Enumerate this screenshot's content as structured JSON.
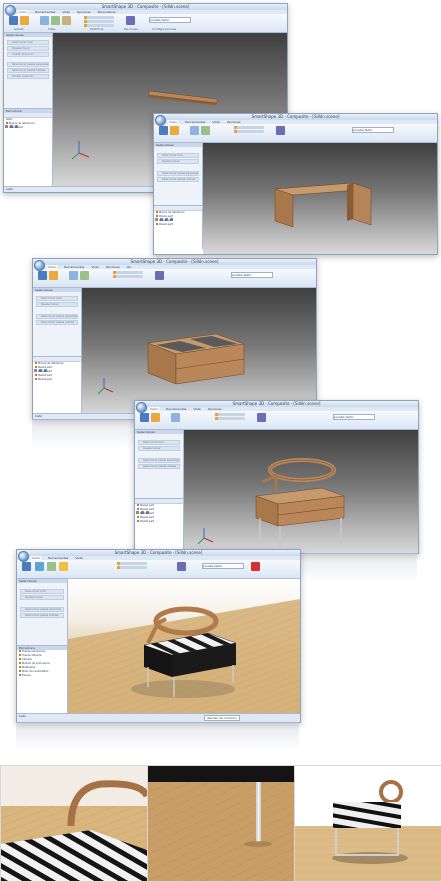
{
  "app": {
    "title": "SmartShape 3D - Composite - [Sillón.scene]",
    "tabs": [
      "Inicio",
      "Herramientas",
      "Vista",
      "Opciones",
      "Personalizar",
      "Ver"
    ],
    "active_tab": "Inicio",
    "ribbon_groups": [
      "Añadir",
      "Vista",
      "Modificar",
      "Opciones",
      "Configuraciones"
    ],
    "ribbon_selector": "prueba texto",
    "left_panel_title": "Selecciones",
    "panel_items": [
      "Seleccionar todo",
      "Deseleccionar",
      "Invertir selección",
      "Seleccionar piezas pequeñas",
      "Seleccionar piezas visibles",
      "Ocultar selección"
    ],
    "tree_title": "Estructura",
    "tree_root": "Sillón",
    "tree_items": [
      "Planos de referencia",
      "Pieza1.part",
      "Pieza2.part",
      "Pieza3.part",
      "Pieza4.part",
      "Pieza5.part"
    ],
    "tree_items_final": [
      "Planos de referencia",
      "Fuente iluminación",
      "Fuente difusora",
      "Cámara",
      "Modelo de iluminación",
      "Materiales",
      "Modo de renderizado",
      "Escena"
    ],
    "status_text": "Listo",
    "status_hint": "Esc: no hay selección. Ninguna pieza seleccionada.",
    "render_label": "Borrador de contorno",
    "render_label_final": "Render de contorno"
  },
  "steps": [
    {
      "name": "step-1",
      "model": "single board"
    },
    {
      "name": "step-2",
      "model": "u-shaped frame"
    },
    {
      "name": "step-3",
      "model": "box with shelf"
    },
    {
      "name": "step-4",
      "model": "frame with round back"
    },
    {
      "name": "step-5",
      "model": "zebra armchair render"
    }
  ],
  "colors": {
    "wood": "#b9875a",
    "wood_dark": "#8a5c36",
    "ribbon": "#dbe6f4",
    "accent_blue": "#3a6db0",
    "floor": "#d7b27a"
  }
}
